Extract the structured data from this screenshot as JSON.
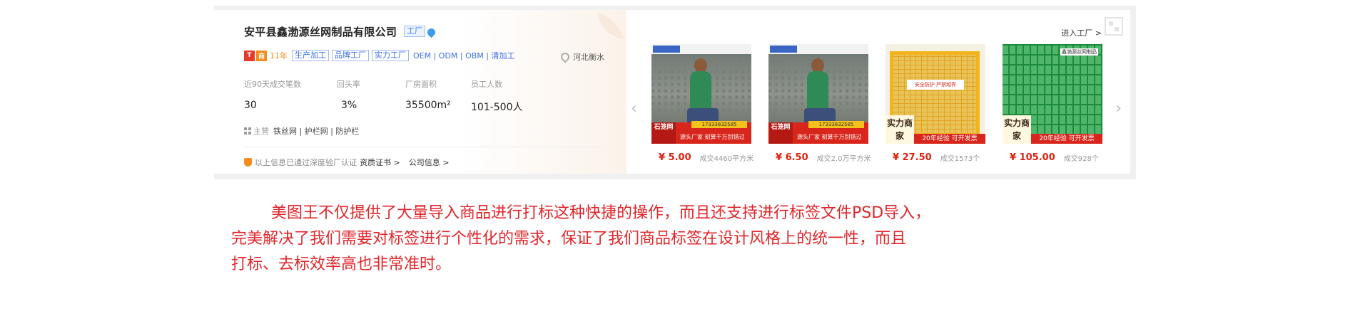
{
  "company": {
    "name": "安平县鑫渤源丝网制品有限公司",
    "factory_tag": "工厂",
    "badge_1": "T",
    "badge_2": "商",
    "years": "11年",
    "tags": [
      "生产加工",
      "品牌工厂",
      "实力工厂"
    ],
    "oem_line": "OEM | ODM | OBM | 清加工",
    "location": "河北衡水",
    "stats": [
      {
        "label": "近90天成交笔数",
        "value": "30"
      },
      {
        "label": "回头率",
        "value": "3%"
      },
      {
        "label": "厂房面积",
        "value": "35500m²"
      },
      {
        "label": "员工人数",
        "value": "101-500人"
      }
    ],
    "main_label": "主营",
    "main_products": "铁丝网 | 护栏网 | 防护栏",
    "verify_text": "以上信息已通过深度验厂认证",
    "link_cert": "资质证书 >",
    "link_info": "公司信息 >"
  },
  "products_panel": {
    "enter_factory": "进入工厂 >",
    "arrow_left": "‹",
    "arrow_right": "›",
    "items": [
      {
        "price": "¥ 5.00",
        "sold": "成交4460平方米",
        "img_logo": "石笼网",
        "img_text": "源头厂家 刻算千万别错过",
        "img_phone": "17333832585"
      },
      {
        "price": "¥ 6.50",
        "sold": "成交2.0万平方米",
        "img_logo": "石笼网",
        "img_text": "源头厂家 刻算千万别错过",
        "img_phone": "17333832585"
      },
      {
        "price": "¥ 27.50",
        "sold": "成交1573个",
        "img_badge": "实力商家",
        "img_bar": "20年经验 可开发票",
        "img_sign": "安全防护 严禁越界"
      },
      {
        "price": "¥ 105.00",
        "sold": "成交928个",
        "img_badge": "实力商家",
        "img_bar": "20年经验 可开发票",
        "img_top": "鑫渤源丝网制品"
      }
    ]
  },
  "paragraph": {
    "line1": "美图王不仅提供了大量导入商品进行打标这种快捷的操作，而且还支持进行标签文件PSD导入，",
    "line2": "完美解决了我们需要对标签进行个性化的需求，保证了我们商品标签在设计风格上的统一性，而且",
    "line3": "打标、去标效率高也非常准时。"
  },
  "colors": {
    "accent_red": "#e0262b",
    "price_red": "#e0210f",
    "tag_blue": "#3b6fe6",
    "orange": "#f58a1f"
  }
}
